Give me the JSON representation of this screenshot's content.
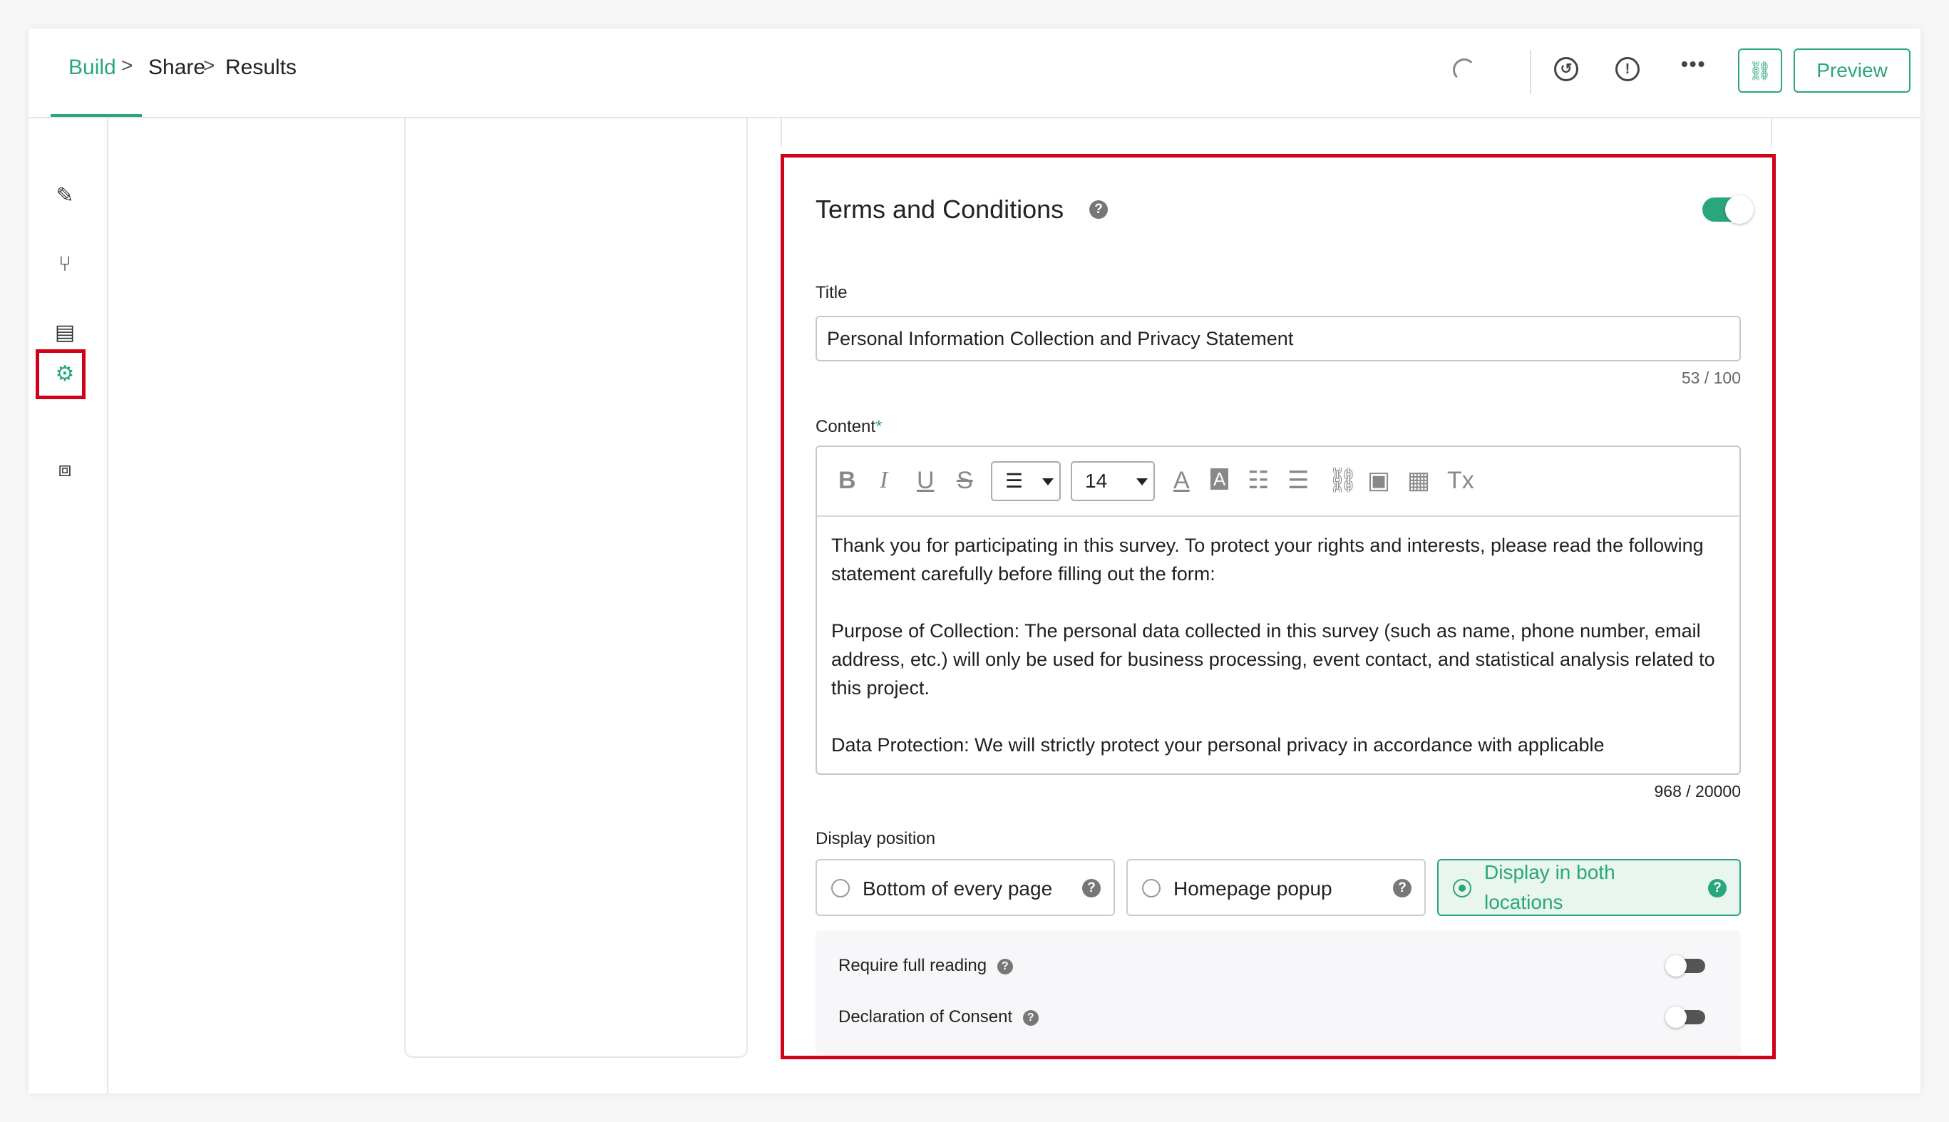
{
  "breadcrumb": {
    "build": "Build",
    "share": "Share",
    "results": "Results",
    "separator": ">"
  },
  "header": {
    "history_icon": "history-icon",
    "alert_icon": "alert-circle-icon",
    "more_icon": "more-horizontal-icon",
    "link_icon": "link-icon",
    "preview_label": "Preview",
    "accent_color": "#2aa77a"
  },
  "rail": {
    "items": [
      {
        "icon": "pencil-icon"
      },
      {
        "icon": "branch-icon"
      },
      {
        "icon": "paint-roller-icon"
      },
      {
        "icon": "gear-icon",
        "active": true
      },
      {
        "icon": "code-icon"
      }
    ]
  },
  "terms": {
    "heading": "Terms and Conditions",
    "enabled": true,
    "title_label": "Title",
    "title_value": "Personal Information Collection and Privacy Statement",
    "title_counter": "53 / 100",
    "content_label": "Content",
    "required_mark": "*",
    "toolbar": {
      "bold": "B",
      "italic": "I",
      "underline": "U",
      "strike": "S",
      "align_glyph": "☰",
      "font_size": "14",
      "font_color": "A",
      "bg_color": "A",
      "clear_format": "Tx"
    },
    "content_paragraphs": [
      "Thank you for participating in this survey. To protect your rights and interests, please read the following statement carefully before filling out the form:",
      "Purpose of Collection: The personal data collected in this survey (such as name, phone number, email address, etc.) will only be used for business processing, event contact, and statistical analysis related to this project.",
      "Data Protection: We will strictly protect your personal privacy in accordance with applicable"
    ],
    "content_counter": "968 / 20000",
    "display_position_label": "Display position",
    "display_options": [
      {
        "label": "Bottom of every page",
        "selected": false
      },
      {
        "label": "Homepage popup",
        "selected": false
      },
      {
        "label": "Display in both locations",
        "selected": true
      }
    ],
    "require_full_reading_label": "Require full reading",
    "require_full_reading": false,
    "declaration_label": "Declaration of Consent",
    "declaration": false,
    "help_glyph": "?"
  }
}
